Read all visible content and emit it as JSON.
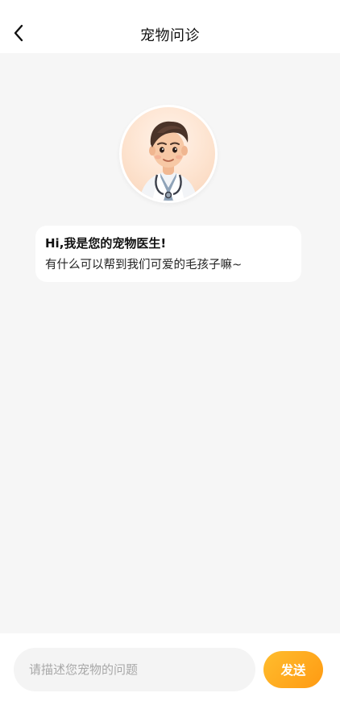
{
  "header": {
    "title": "宠物问诊",
    "back_icon": "chevron-left-icon"
  },
  "doctor": {
    "avatar_icon": "doctor-avatar"
  },
  "message": {
    "line1": "Hi,我是您的宠物医生!",
    "line2": "有什么可以帮到我们可爱的毛孩子嘛~"
  },
  "composer": {
    "placeholder": "请描述您宠物的问题",
    "send_label": "发送",
    "accent_color": "#ffa61e"
  }
}
